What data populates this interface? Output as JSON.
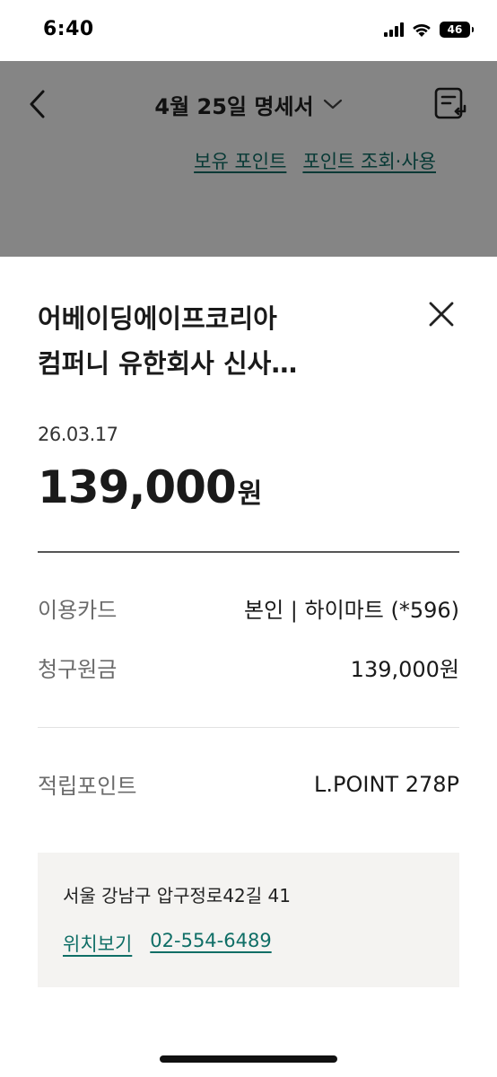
{
  "status_bar": {
    "time": "6:40",
    "battery_level": "46"
  },
  "background_page": {
    "title": "4월 25일 명세서",
    "links": [
      "보유 포인트",
      "포인트 조회·사용"
    ]
  },
  "sheet": {
    "merchant_line1": "어베이딩에이프코리아",
    "merchant_line2": "컴퍼니 유한회사 신사…",
    "date": "26.03.17",
    "amount": "139,000",
    "amount_unit": "원",
    "rows": {
      "card": {
        "label": "이용카드",
        "value": "본인 | 하이마트 (*596)"
      },
      "principal": {
        "label": "청구원금",
        "value": "139,000원"
      },
      "points": {
        "label": "적립포인트",
        "value": "L.POINT 278P"
      }
    },
    "address": "서울 강남구 압구정로42길 41",
    "location_link": "위치보기",
    "phone": "02-554-6489"
  },
  "colors": {
    "link": "#0f6e66",
    "overlay": "rgba(0,0,0,0.48)",
    "address_bg": "#f4f3f1"
  }
}
